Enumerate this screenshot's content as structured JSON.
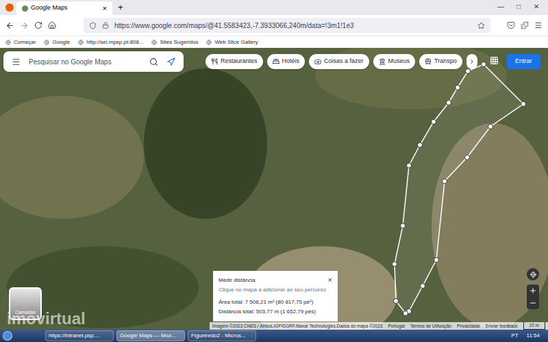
{
  "window": {
    "controls": [
      "—",
      "□",
      "✕"
    ]
  },
  "tabs": [
    {
      "label": "Google Maps",
      "selected": true,
      "close": "×"
    }
  ],
  "new_tab": "+",
  "address_bar": {
    "url": "https://www.google.com/maps/@41.5583423,-7.3933066,240m/data=!3m1!1e3"
  },
  "bookmarks": [
    {
      "label": "Começar"
    },
    {
      "label": "Google"
    },
    {
      "label": "http://sei.mpsp.pt:808..."
    },
    {
      "label": "Sites Sugeridos"
    },
    {
      "label": "Web Slice Gallery"
    }
  ],
  "map": {
    "search": {
      "placeholder": "Pesquisar no Google Maps"
    },
    "chips": [
      {
        "label": "Restaurantes"
      },
      {
        "label": "Hotéis"
      },
      {
        "label": "Coisas a fazer"
      },
      {
        "label": "Museus"
      },
      {
        "label": "Transpo"
      }
    ],
    "sign_in": "Entrar",
    "measure": {
      "title": "Medir distância",
      "hint": "Clique no mapa a adicionar ao seu percurso",
      "area": "Área total: 7 508,21 m² (80 817,75 pé²)",
      "distance": "Distância total: 503,77 m (1 652,79 pés)",
      "close": "×"
    },
    "layers": "Camadas",
    "watermark": "imovirtual",
    "attribution": [
      "Imagem ©2023 CNES / Airbus,IGP/DGRF,Maxar Technologies,Dados do mapa ©2023",
      "Portugal",
      "Termos de Utilização",
      "Privacidade",
      "Enviar feedback"
    ],
    "scale": "20 m"
  },
  "taskbar": {
    "items": [
      {
        "label": "https://intranet.psp....",
        "selected": false
      },
      {
        "label": "Google Maps — Moz...",
        "selected": true
      },
      {
        "label": "Figueiredo2 - Micros...",
        "selected": false
      }
    ],
    "language": "PT",
    "clock": "11:54"
  }
}
